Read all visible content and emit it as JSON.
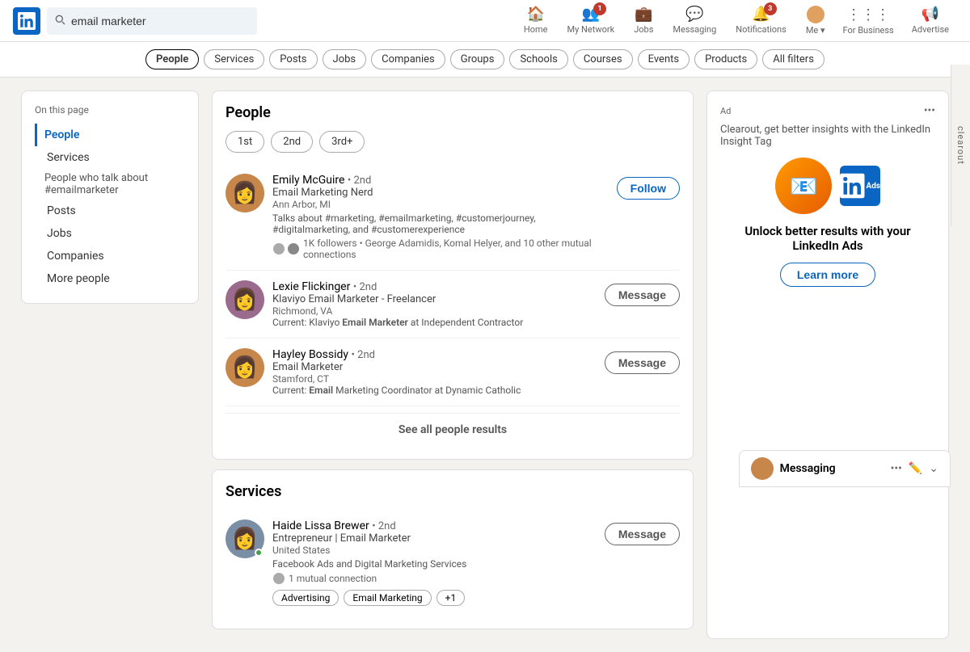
{
  "header": {
    "logo_alt": "LinkedIn",
    "search_value": "email marketer",
    "search_placeholder": "Search",
    "nav": [
      {
        "id": "home",
        "label": "Home",
        "icon": "🏠",
        "badge": null
      },
      {
        "id": "my-network",
        "label": "My Network",
        "icon": "👥",
        "badge": "1"
      },
      {
        "id": "jobs",
        "label": "Jobs",
        "icon": "💼",
        "badge": null
      },
      {
        "id": "messaging",
        "label": "Messaging",
        "icon": "💬",
        "badge": null
      },
      {
        "id": "notifications",
        "label": "Notifications",
        "icon": "🔔",
        "badge": "3"
      },
      {
        "id": "me",
        "label": "Me",
        "icon": "me"
      },
      {
        "id": "for-business",
        "label": "For Business",
        "icon": "⋮⋮⋮"
      },
      {
        "id": "advertise",
        "label": "Advertise",
        "icon": "📢"
      }
    ]
  },
  "filter_bar": {
    "chips": [
      {
        "id": "people",
        "label": "People",
        "active": true
      },
      {
        "id": "services",
        "label": "Services",
        "active": false
      },
      {
        "id": "posts",
        "label": "Posts",
        "active": false
      },
      {
        "id": "jobs",
        "label": "Jobs",
        "active": false
      },
      {
        "id": "companies",
        "label": "Companies",
        "active": false
      },
      {
        "id": "groups",
        "label": "Groups",
        "active": false
      },
      {
        "id": "schools",
        "label": "Schools",
        "active": false
      },
      {
        "id": "courses",
        "label": "Courses",
        "active": false
      },
      {
        "id": "events",
        "label": "Events",
        "active": false
      },
      {
        "id": "products",
        "label": "Products",
        "active": false
      },
      {
        "id": "all-filters",
        "label": "All filters",
        "active": false
      }
    ]
  },
  "sidebar": {
    "on_this_page": "On this page",
    "items": [
      {
        "id": "people",
        "label": "People",
        "active": true
      },
      {
        "id": "services",
        "label": "Services",
        "active": false
      },
      {
        "id": "people-who-talk",
        "label": "People who talk about #emailmarketer",
        "active": false,
        "sub": true
      },
      {
        "id": "posts",
        "label": "Posts",
        "active": false
      },
      {
        "id": "jobs",
        "label": "Jobs",
        "active": false
      },
      {
        "id": "companies",
        "label": "Companies",
        "active": false
      },
      {
        "id": "more-people",
        "label": "More people",
        "active": false
      }
    ]
  },
  "people_section": {
    "title": "People",
    "filters": [
      {
        "id": "1st",
        "label": "1st"
      },
      {
        "id": "2nd",
        "label": "2nd"
      },
      {
        "id": "3rd",
        "label": "3rd+"
      }
    ],
    "people": [
      {
        "id": "emily",
        "name": "Emily McGuire",
        "degree": "• 2nd",
        "title": "Email Marketing Nerd",
        "location": "Ann Arbor, MI",
        "desc": "Talks about #marketing, #emailmarketing, #customerjourney, #digitalmarketing, and #customerexperience",
        "mutual_text": "1K followers • George Adamidis, Komal Helyer, and 10 other mutual connections",
        "action": "Follow",
        "avatar_color": "#c8874a",
        "avatar_emoji": "👩"
      },
      {
        "id": "lexie",
        "name": "Lexie Flickinger",
        "degree": "• 2nd",
        "title": "Klaviyo Email Marketer - Freelancer",
        "location": "Richmond, VA",
        "desc_pre": "Current: Klaviyo ",
        "desc_bold": "Email Marketer",
        "desc_post": " at Independent Contractor",
        "action": "Message",
        "avatar_color": "#9b6b8e",
        "avatar_emoji": "👩"
      },
      {
        "id": "hayley",
        "name": "Hayley Bossidy",
        "degree": "• 2nd",
        "title": "Email Marketer",
        "location": "Stamford, CT",
        "desc_pre": "Current: ",
        "desc_bold": "Email",
        "desc_post": " Marketing Coordinator at Dynamic Catholic",
        "action": "Message",
        "avatar_color": "#c8874a",
        "avatar_emoji": "👩"
      }
    ],
    "see_all": "See all people results"
  },
  "services_section": {
    "title": "Services",
    "person": {
      "id": "haide",
      "name": "Haide Lissa Brewer",
      "degree": "• 2nd",
      "title": "Entrepreneur | Email Marketer",
      "location": "United States",
      "desc": "Facebook Ads and Digital Marketing Services",
      "mutual_text": "1 mutual connection",
      "action": "Message",
      "online": true,
      "avatar_color": "#7a8fa6",
      "avatar_emoji": "👩",
      "tags": [
        "Advertising",
        "Email Marketing",
        "+1"
      ]
    }
  },
  "ad": {
    "label": "Ad",
    "company": "Clearout",
    "text": "Clearout, get better insights with the LinkedIn Insight Tag",
    "headline": "Unlock better results with your LinkedIn Ads",
    "btn": "Learn more",
    "logo_emoji": "📧"
  },
  "clearout_strip": "clearout",
  "messaging_bar": {
    "label": "Messaging",
    "avatar_color": "#c8874a"
  }
}
